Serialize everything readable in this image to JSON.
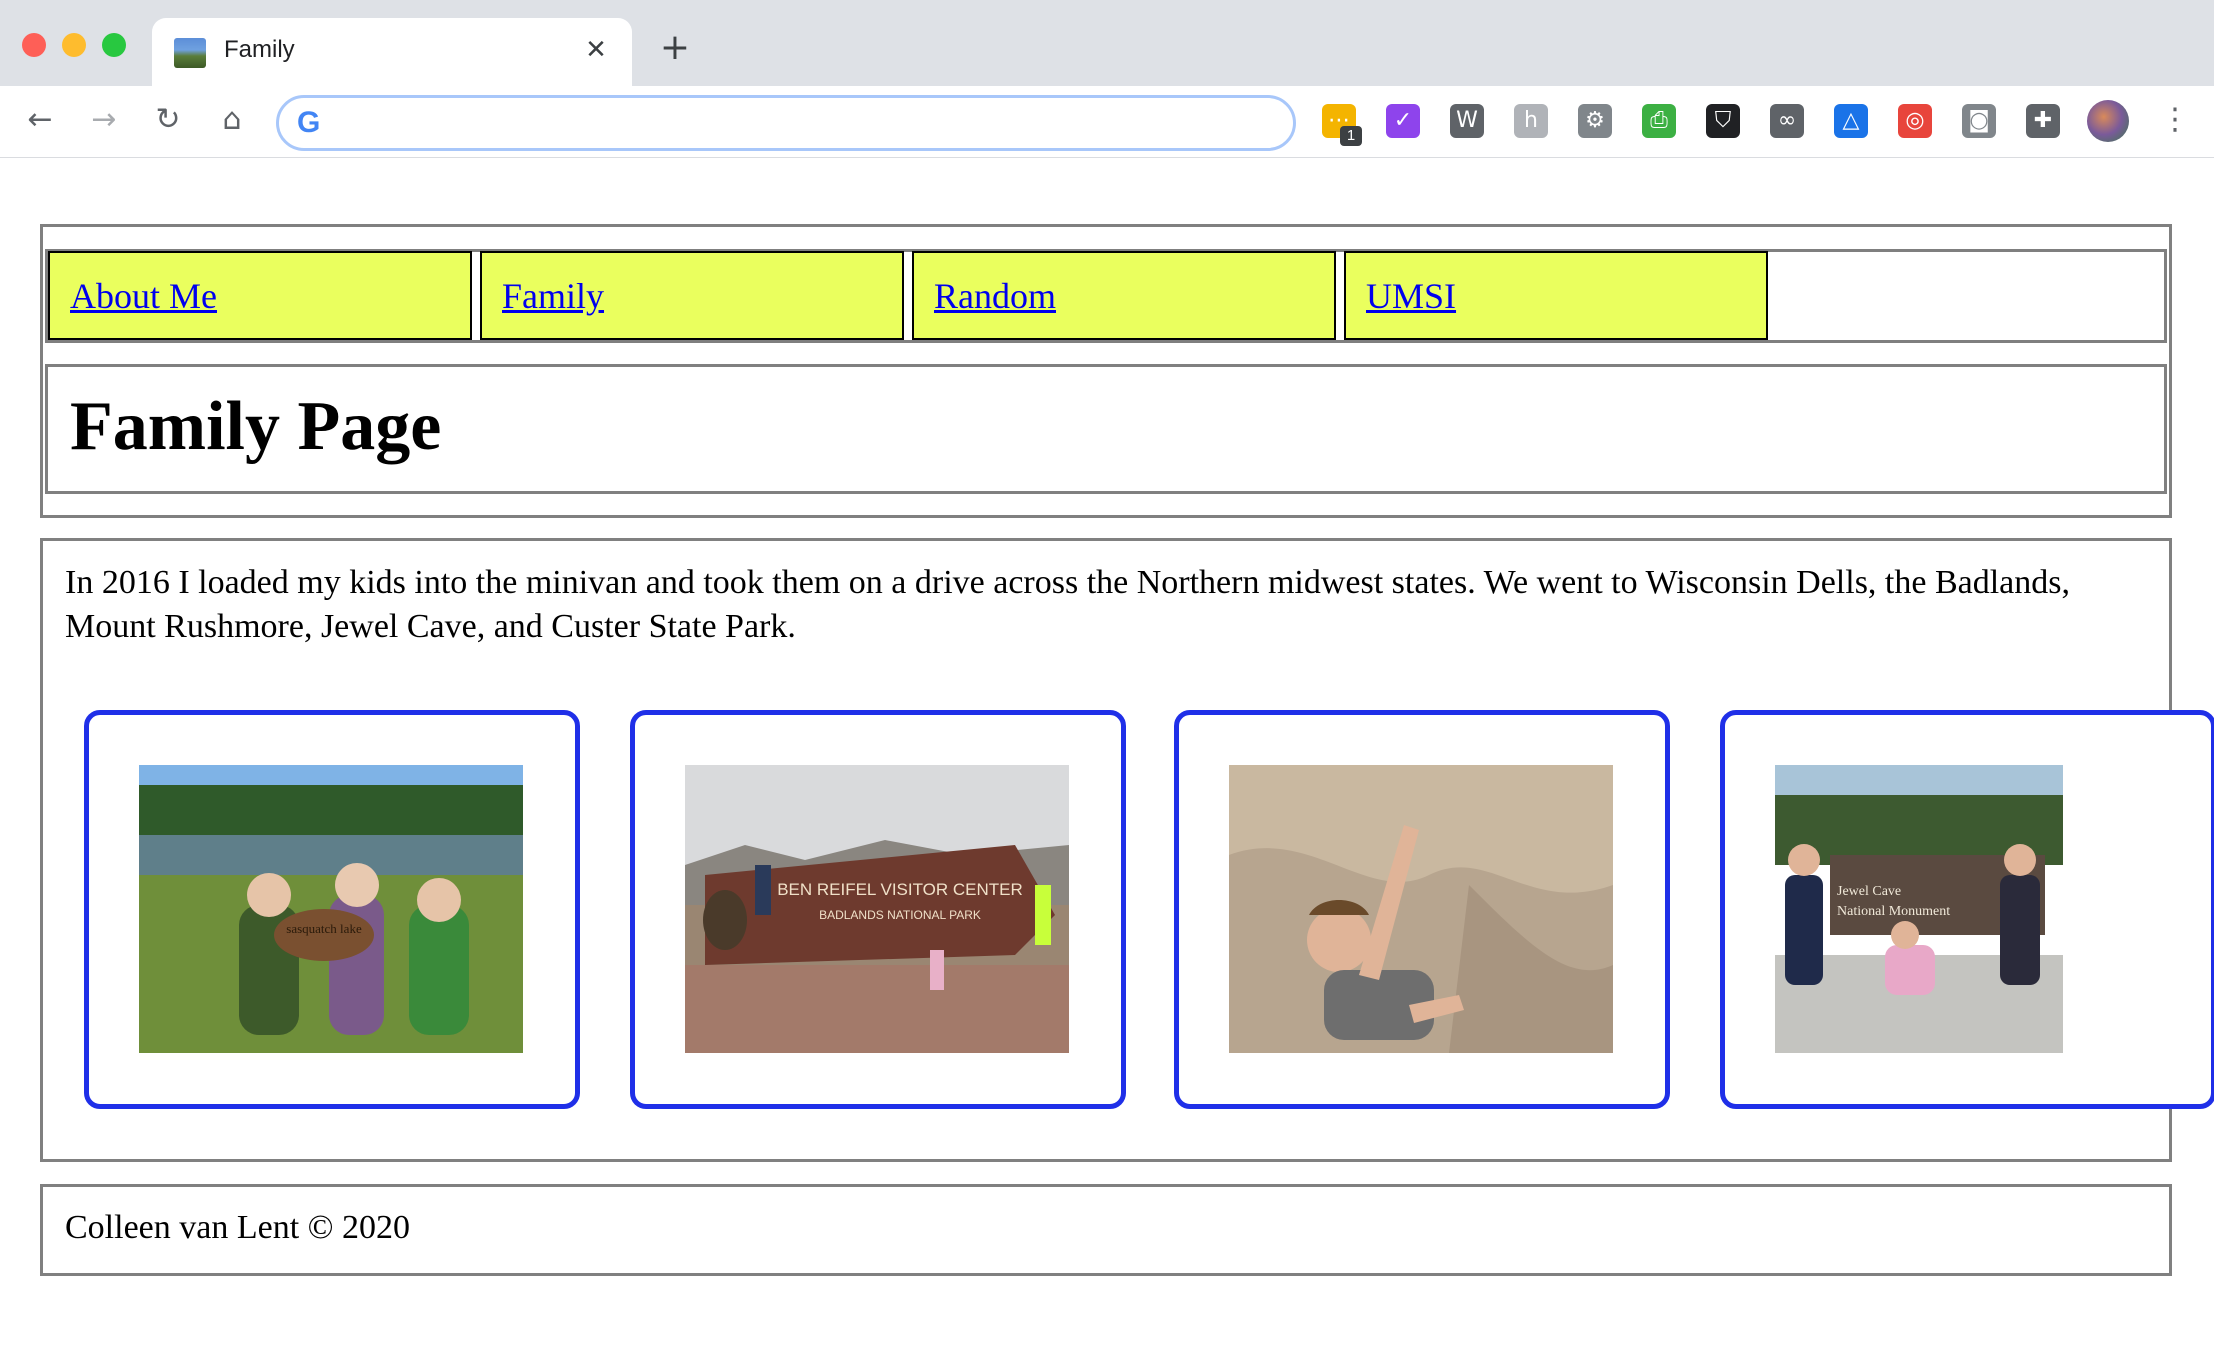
{
  "browser": {
    "tab_title": "Family",
    "tab_close_glyph": "✕",
    "new_tab_glyph": "+",
    "nav": {
      "back": "←",
      "forward": "→",
      "reload": "↻",
      "home": "⌂"
    },
    "omnibox": {
      "logo": "G",
      "value": "",
      "placeholder": ""
    },
    "extensions": [
      {
        "name": "sticky-notes-icon",
        "color": "#f4b400",
        "glyph": "⋯",
        "badge": "1"
      },
      {
        "name": "checkmark-extension-icon",
        "color": "#8e44ec",
        "glyph": "✓"
      },
      {
        "name": "w-logo-icon",
        "color": "#5f6368",
        "glyph": "W"
      },
      {
        "name": "h-extension-icon",
        "color": "#b0b3b8",
        "glyph": "h"
      },
      {
        "name": "gear-extension-icon",
        "color": "#80868b",
        "glyph": "⚙"
      },
      {
        "name": "print-friendly-icon",
        "color": "#3cb043",
        "glyph": "⎙"
      },
      {
        "name": "shield-icon",
        "color": "#202124",
        "glyph": "⛉"
      },
      {
        "name": "glasses-icon",
        "color": "#5f6368",
        "glyph": "∞"
      },
      {
        "name": "ax-triangle-icon",
        "color": "#1a73e8",
        "glyph": "△"
      },
      {
        "name": "color-wheel-icon",
        "color": "#e8453c",
        "glyph": "◎"
      },
      {
        "name": "camera-icon",
        "color": "#80868b",
        "glyph": "◙"
      },
      {
        "name": "puzzle-icon",
        "color": "#5f6368",
        "glyph": "✚"
      }
    ],
    "menu_glyph": "⋮"
  },
  "page": {
    "nav_items": [
      "About Me",
      "Family",
      "Random",
      "UMSI"
    ],
    "title": "Family Page",
    "intro": "In 2016 I loaded my kids into the minivan and took them on a drive across the Northern midwest states. We went to Wisconsin Dells, the Badlands, Mount Rushmore, Jewel Cave, and Custer State Park.",
    "photos": [
      {
        "name": "photo-sasquatch-lake",
        "sign": "sasquatch lake"
      },
      {
        "name": "photo-visitor-center",
        "sign_line1": "BEN REIFEL VISITOR CENTER",
        "sign_line2": "BADLANDS NATIONAL PARK"
      },
      {
        "name": "photo-rock-climb"
      },
      {
        "name": "photo-jewel-cave",
        "sign_line1": "Jewel Cave",
        "sign_line2": "National Monument"
      }
    ],
    "footer": "Colleen van Lent © 2020",
    "colors": {
      "nav_bg": "#eaff5e",
      "link": "#0000ee",
      "card_border": "#1f2fe8",
      "box_border": "#808080"
    }
  }
}
